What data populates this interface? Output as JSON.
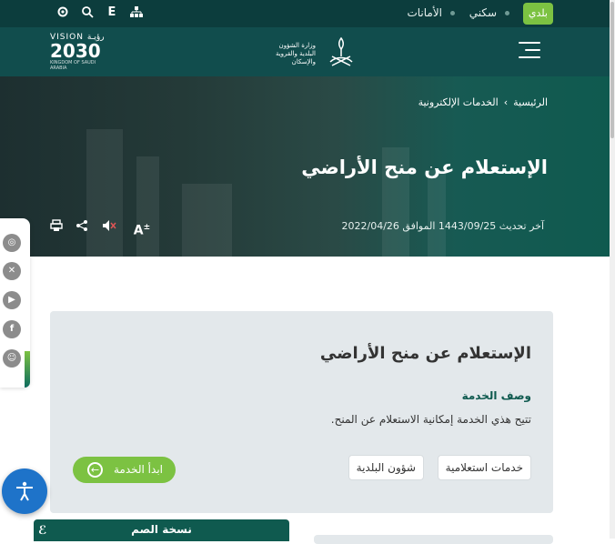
{
  "topbar": {
    "pill": "بلدي",
    "link_sakani": "سكني",
    "link_amanat": "الأمانات",
    "icon_e": "E",
    "icons": [
      "settings-icon",
      "search-icon",
      "E",
      "sitemap-icon"
    ]
  },
  "header": {
    "vision_line1": "VISION",
    "vision_arabic": "رؤيـة",
    "vision_year": "2030",
    "vision_line3": "KINGDOM OF SAUDI ARABIA",
    "ministry_name": "وزارة الشؤون البلدية والقروية والإسكان"
  },
  "hero": {
    "crumb_home": "الرئيسية",
    "crumb_sep": "›",
    "crumb_services": "الخدمات الإلكترونية",
    "title": "الإستعلام عن منح الأراضي",
    "updated": "آخر تحديث 1443/09/25 الموافق 2022/04/26",
    "tools": [
      "font-size-icon",
      "mute-icon",
      "share-icon",
      "print-icon"
    ]
  },
  "social": [
    "instagram-icon",
    "x-icon",
    "youtube-icon",
    "facebook-icon",
    "snapchat-icon"
  ],
  "card": {
    "title": "الإستعلام عن منح الأراضي",
    "desc_heading": "وصف الخدمة",
    "desc_text": "تتيح هذي الخدمة إمكانية الاستعلام عن المنح.",
    "tag1": "خدمات استعلامية",
    "tag2": "شؤون البلدية",
    "start_label": "ابدأ الخدمة"
  },
  "deaf_version": "نسخة الصم",
  "colors": {
    "dark_teal": "#0c3d3d",
    "teal": "#0f5a4f",
    "green": "#7cc242",
    "blue": "#1e73c9"
  }
}
